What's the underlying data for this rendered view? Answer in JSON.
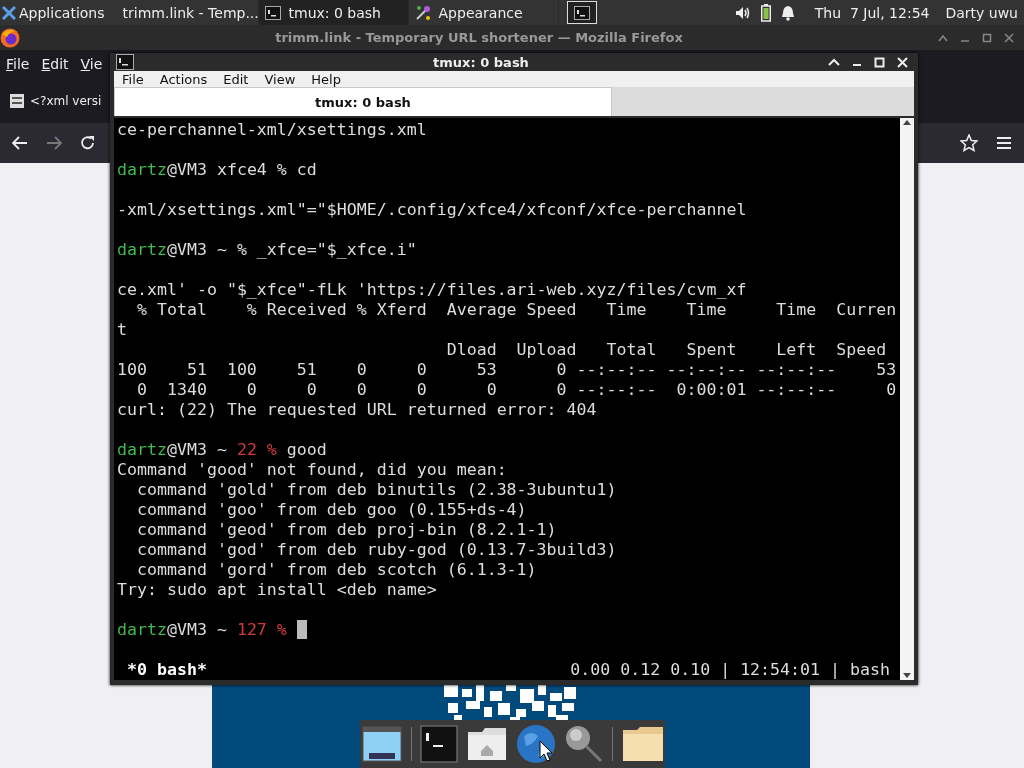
{
  "top_panel": {
    "applications_label": "Applications",
    "tasks": [
      {
        "label": "trimm.link - Temp...",
        "kind": "browser",
        "selected": false
      },
      {
        "label": "tmux: 0 bash",
        "kind": "terminal",
        "selected": true
      },
      {
        "label": "Appearance",
        "kind": "settings",
        "selected": false
      }
    ],
    "clock": "Thu  7 Jul, 12:54",
    "user": "Darty uwu"
  },
  "browser": {
    "title": "trimm.link - Temporary URL shortener — Mozilla Firefox",
    "menu": [
      "File",
      "Edit",
      "Vie"
    ],
    "tab": "<?xml versi"
  },
  "terminal": {
    "title": "tmux: 0 bash",
    "menu": [
      "File",
      "Actions",
      "Edit",
      "View",
      "Help"
    ],
    "tabs": [
      {
        "label": "tmux: 0 bash",
        "selected": true
      }
    ],
    "blocks": [
      [
        {
          "segments": [
            {
              "text": "ce-perchannel-xml/xsettings.xml",
              "kind": "plain"
            }
          ]
        }
      ],
      [
        {
          "segments": [
            {
              "text": "dartz",
              "kind": "user"
            },
            {
              "text": "@VM3 xfce4 % cd",
              "kind": "plain"
            }
          ]
        }
      ],
      [
        {
          "segments": [
            {
              "text": "-xml/xsettings.xml\"=\"$HOME/.config/xfce4/xfconf/xfce-perchannel",
              "kind": "plain"
            }
          ]
        }
      ],
      [
        {
          "segments": [
            {
              "text": "dartz",
              "kind": "user"
            },
            {
              "text": "@VM3 ~ % _xfce=\"$_xfce.i\"",
              "kind": "plain"
            }
          ]
        }
      ],
      [
        {
          "segments": [
            {
              "text": "ce.xml' -o \"$_xfce\"-fLk 'https://files.ari-web.xyz/files/cvm_xf",
              "kind": "plain"
            }
          ]
        },
        {
          "segments": [
            {
              "text": "  % Total    % Received % Xferd  Average Speed   Time    Time     Time  Curren",
              "kind": "plain"
            }
          ]
        },
        {
          "segments": [
            {
              "text": "t",
              "kind": "plain"
            }
          ]
        },
        {
          "segments": [
            {
              "text": "                                 Dload  Upload   Total   Spent    Left  Speed",
              "kind": "plain"
            }
          ]
        },
        {
          "segments": [
            {
              "text": "100    51  100    51    0     0     53      0 --:--:-- --:--:-- --:--:--    53",
              "kind": "plain"
            }
          ]
        },
        {
          "segments": [
            {
              "text": "  0  1340    0     0    0     0      0      0 --:--:--  0:00:01 --:--:--     0",
              "kind": "plain"
            }
          ]
        },
        {
          "segments": [
            {
              "text": "curl: (22) The requested URL returned error: 404",
              "kind": "plain"
            }
          ]
        }
      ],
      [
        {
          "segments": [
            {
              "text": "dartz",
              "kind": "user"
            },
            {
              "text": "@VM3 ~ ",
              "kind": "plain"
            },
            {
              "text": "22 %",
              "kind": "code"
            },
            {
              "text": " good",
              "kind": "plain"
            }
          ]
        },
        {
          "segments": [
            {
              "text": "Command 'good' not found, did you mean:",
              "kind": "plain"
            }
          ]
        },
        {
          "segments": [
            {
              "text": "  command 'gold' from deb binutils (2.38-3ubuntu1)",
              "kind": "plain"
            }
          ]
        },
        {
          "segments": [
            {
              "text": "  command 'goo' from deb goo (0.155+ds-4)",
              "kind": "plain"
            }
          ]
        },
        {
          "segments": [
            {
              "text": "  command 'geod' from deb proj-bin (8.2.1-1)",
              "kind": "plain"
            }
          ]
        },
        {
          "segments": [
            {
              "text": "  command 'god' from deb ruby-god (0.13.7-3build3)",
              "kind": "plain"
            }
          ]
        },
        {
          "segments": [
            {
              "text": "  command 'gord' from deb scotch (6.1.3-1)",
              "kind": "plain"
            }
          ]
        },
        {
          "segments": [
            {
              "text": "Try: sudo apt install <deb name>",
              "kind": "plain"
            }
          ]
        }
      ],
      [
        {
          "segments": [
            {
              "text": "dartz",
              "kind": "user"
            },
            {
              "text": "@VM3 ~ ",
              "kind": "plain"
            },
            {
              "text": "127 %",
              "kind": "code"
            }
          ],
          "cursor": true
        }
      ]
    ],
    "status_left": " *0 bash*",
    "status_right": "0.00 0.12 0.10 | 12:54:01 | bash"
  }
}
